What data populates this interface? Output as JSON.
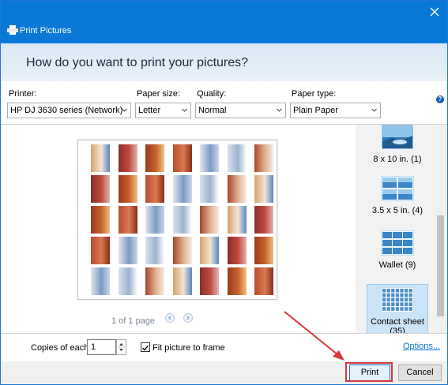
{
  "window": {
    "title": "Print Pictures",
    "question": "How do you want to print your pictures?"
  },
  "printer": {
    "label": "Printer:",
    "value": "HP DJ 3630 series (Network)"
  },
  "paper_size": {
    "label": "Paper size:",
    "value": "Letter"
  },
  "quality": {
    "label": "Quality:",
    "value": "Normal"
  },
  "paper_type": {
    "label": "Paper type:",
    "value": "Plain Paper"
  },
  "help": "?",
  "preview": {
    "page_text": "1 of 1 page"
  },
  "layouts": [
    {
      "label": "8 x 10 in. (1)",
      "icon": "single-photo-icon"
    },
    {
      "label": "3.5 x 5 in. (4)",
      "icon": "four-photo-icon"
    },
    {
      "label": "Wallet (9)",
      "icon": "wallet-photo-icon"
    },
    {
      "label": "Contact sheet",
      "label2": "(35)",
      "icon": "contact-sheet-icon",
      "selected": true
    }
  ],
  "copies": {
    "label": "Copies of each",
    "value": "1"
  },
  "fit": {
    "label": "Fit picture to frame",
    "checked": true
  },
  "options_link": "Options...",
  "buttons": {
    "print": "Print",
    "cancel": "Cancel"
  },
  "colors": {
    "titlebar": "#0a78d7",
    "highlight": "#d9353a",
    "link": "#0a6fd1"
  }
}
